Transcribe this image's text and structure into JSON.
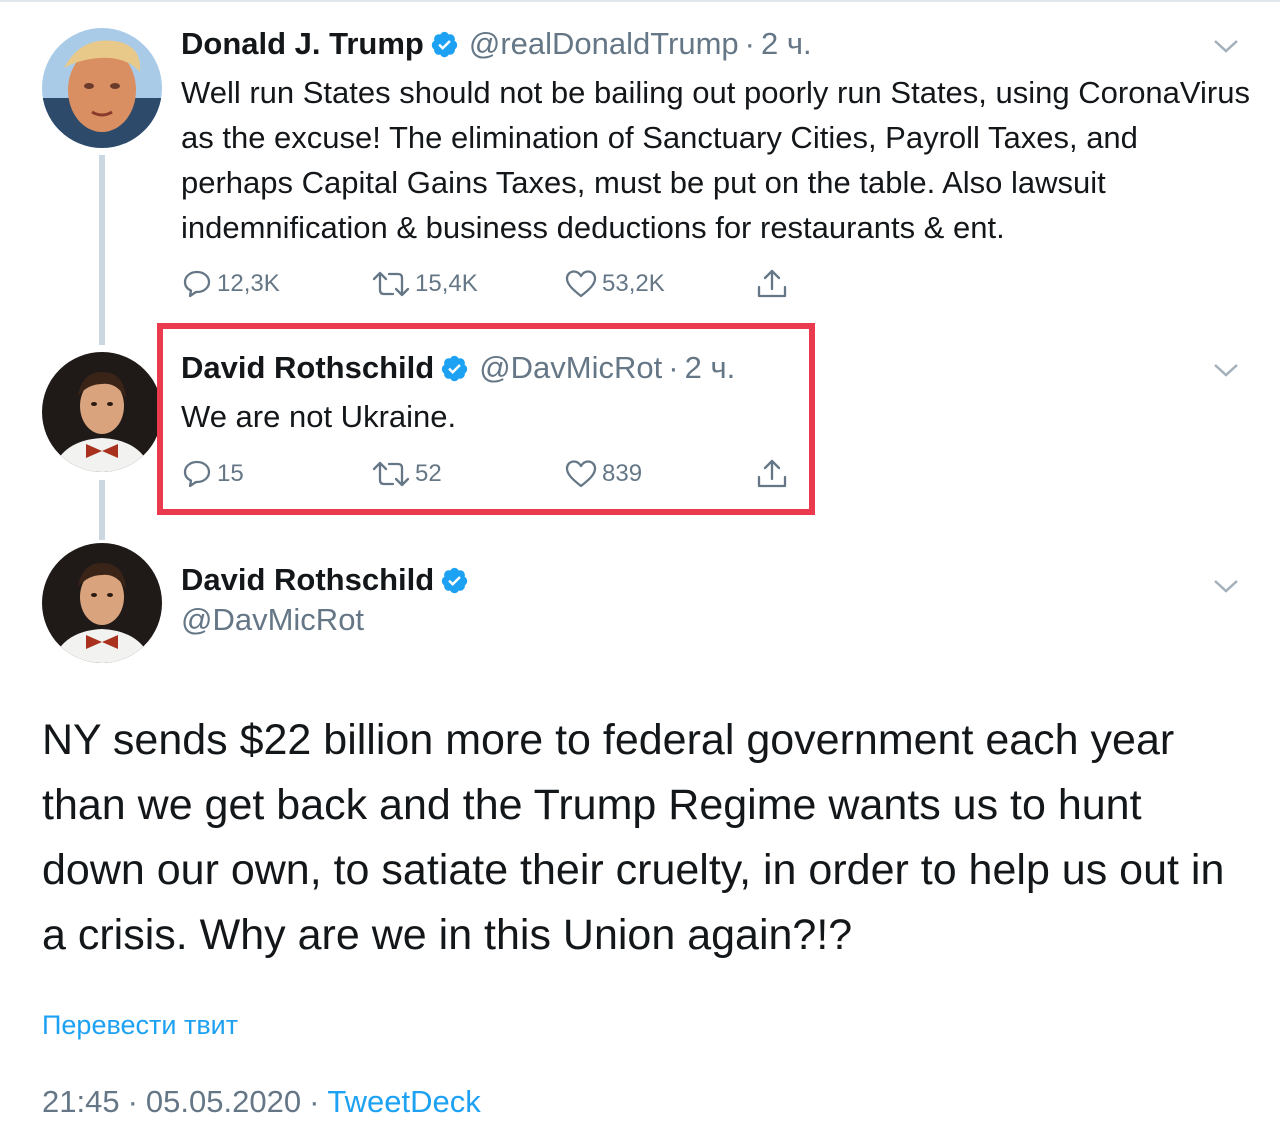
{
  "colors": {
    "text": "#14171a",
    "secondary": "#657786",
    "link": "#1da1f2",
    "verified": "#1da1f2",
    "highlight": "#ea3b4e"
  },
  "tweets": [
    {
      "name": "Donald J. Trump",
      "handle": "@realDonaldTrump",
      "time": "2 ч.",
      "text": "Well run States should not be bailing out poorly run States, using CoronaVirus as the excuse! The elimination of Sanctuary Cities, Payroll Taxes, and perhaps Capital Gains Taxes, must be put on the table. Also lawsuit indemnification & business deductions for restaurants & ent.",
      "replies": "12,3K",
      "retweets": "15,4K",
      "likes": "53,2K"
    },
    {
      "name": "David Rothschild",
      "handle": "@DavMicRot",
      "time": "2 ч.",
      "text": "We are not Ukraine.",
      "replies": "15",
      "retweets": "52",
      "likes": "839"
    }
  ],
  "main": {
    "name": "David Rothschild",
    "handle": "@DavMicRot",
    "text": "NY sends $22 billion more to federal government each year than we get back and the Trump Regime wants us to hunt down our own, to satiate their cruelty, in order to help us out in a crisis. Why are we in this Union again?!?",
    "translate": "Перевести твит",
    "time": "21:45",
    "date": "05.05.2020",
    "source": "TweetDeck"
  },
  "icons": {
    "reply": "reply-icon",
    "retweet": "retweet-icon",
    "like": "heart-icon",
    "share": "share-icon",
    "verified": "verified-badge-icon",
    "caret": "chevron-down-icon"
  }
}
